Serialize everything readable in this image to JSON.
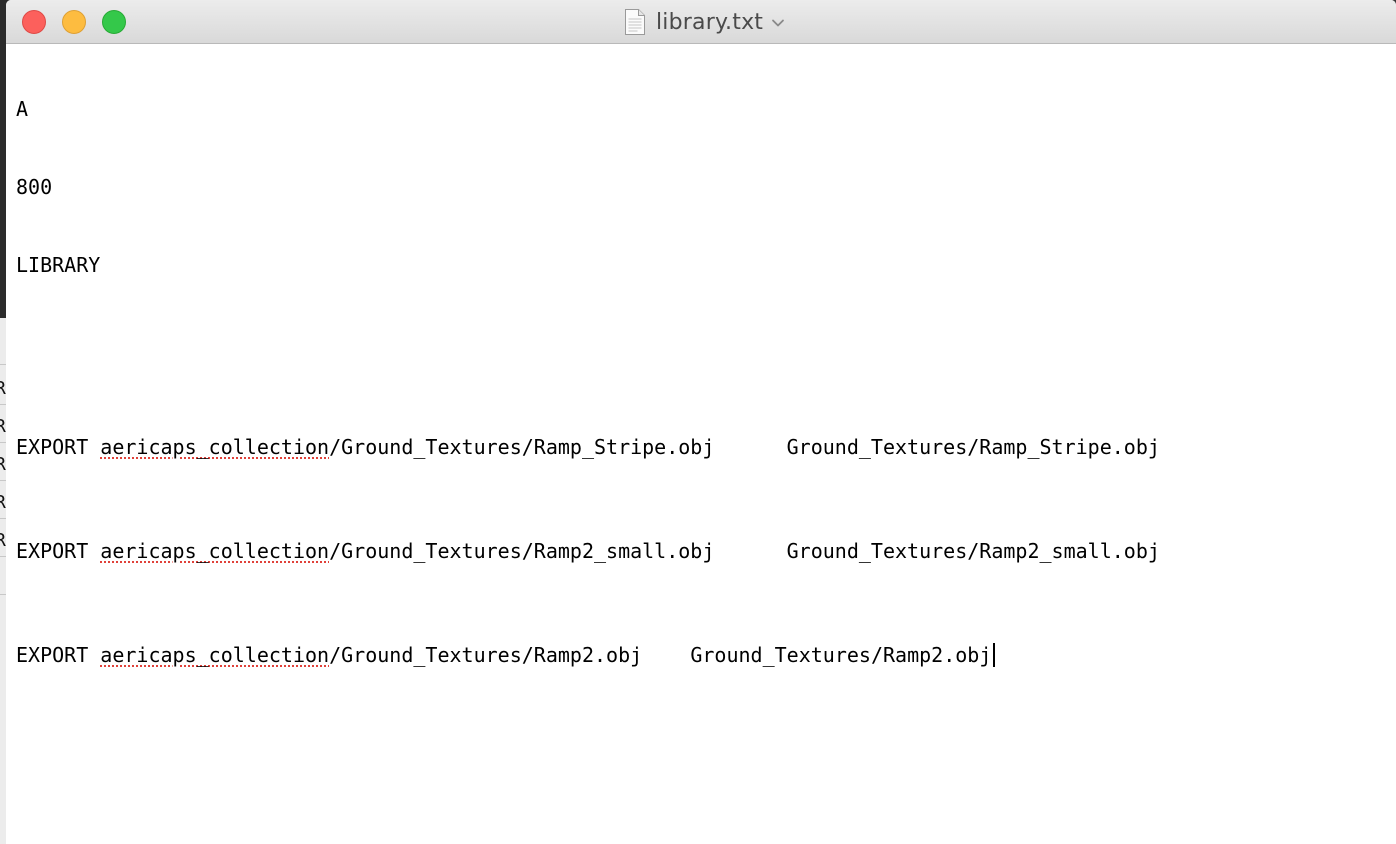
{
  "background_app": {
    "letters": [
      "R",
      "R",
      "R",
      "R",
      "R"
    ]
  },
  "window": {
    "title": "library.txt",
    "icons": {
      "document": "document-icon",
      "title_menu": "chevron-down-icon",
      "close": "close-button",
      "minimize": "minimize-button",
      "zoom": "zoom-button"
    },
    "colors": {
      "close": "#fc605c",
      "minimize": "#fdbc40",
      "zoom": "#34c84a",
      "spellcheck_underline": "#e0413a"
    }
  },
  "document": {
    "line1": "A",
    "line2": "800",
    "line3": "LIBRARY",
    "line4": "",
    "exports": [
      {
        "keyword": "EXPORT ",
        "misspelled": "aericaps_collection",
        "path_rest": "/Ground_Textures/Ramp_Stripe.obj",
        "gap": "      ",
        "target": "Ground_Textures/Ramp_Stripe.obj"
      },
      {
        "keyword": "EXPORT ",
        "misspelled": "aericaps_collection",
        "path_rest": "/Ground_Textures/Ramp2_small.obj",
        "gap": "      ",
        "target": "Ground_Textures/Ramp2_small.obj"
      },
      {
        "keyword": "EXPORT ",
        "misspelled": "aericaps_collection",
        "path_rest": "/Ground_Textures/Ramp2.obj",
        "gap": "    ",
        "target": "Ground_Textures/Ramp2.obj"
      }
    ]
  }
}
